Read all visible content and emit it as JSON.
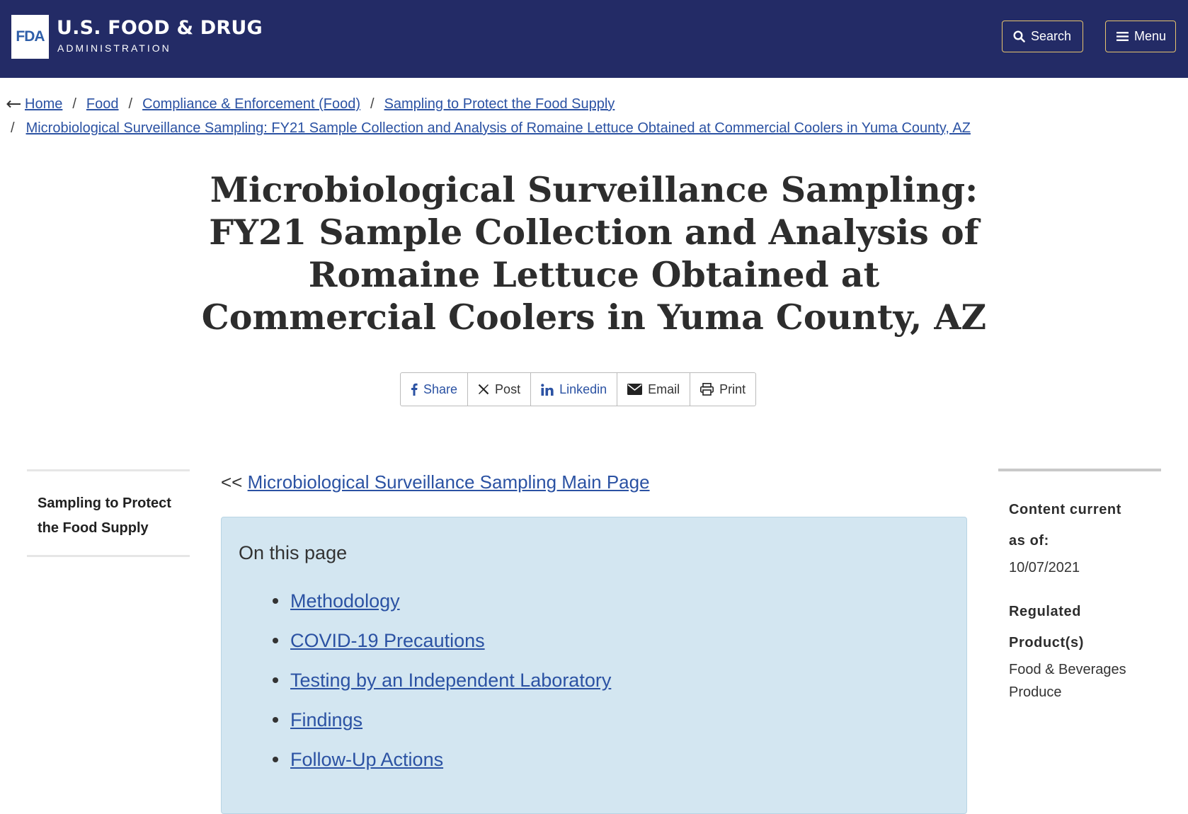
{
  "header": {
    "logo_text": "FDA",
    "agency_name": "U.S. FOOD & DRUG",
    "agency_sub": "ADMINISTRATION",
    "search_label": "Search",
    "menu_label": "Menu",
    "background_color": "#232b66",
    "button_border_color": "#e7c46e"
  },
  "breadcrumbs": {
    "items": [
      "Home",
      "Food",
      "Compliance & Enforcement (Food)",
      "Sampling to Protect the Food Supply",
      "Microbiological Surveillance Sampling: FY21 Sample Collection and Analysis of Romaine Lettuce Obtained at Commercial Coolers in Yuma County, AZ"
    ],
    "separator": "/"
  },
  "page": {
    "title": "Microbiological Surveillance Sampling: FY21 Sample Collection and Analysis of Romaine Lettuce Obtained at Commercial Coolers in Yuma County, AZ"
  },
  "share": {
    "facebook": "Share",
    "x": "Post",
    "linkedin": "Linkedin",
    "email": "Email",
    "print": "Print"
  },
  "left_nav": {
    "title": "Sampling to Protect the Food Supply"
  },
  "main": {
    "back_prefix": "<<",
    "back_link": "Microbiological Surveillance Sampling Main Page",
    "toc_heading": "On this page",
    "toc_items": [
      "Methodology",
      "COVID-19 Precautions",
      "Testing by an Independent Laboratory",
      "Findings",
      "Follow-Up Actions"
    ]
  },
  "meta": {
    "content_current_label_1": "Content current",
    "content_current_label_2": "as of:",
    "content_current_value": "10/07/2021",
    "regulated_label_1": "Regulated",
    "regulated_label_2": "Product(s)",
    "regulated_values": [
      "Food & Beverages",
      "Produce"
    ]
  },
  "colors": {
    "link": "#2b52a3",
    "toc_background": "#d3e6f1"
  }
}
